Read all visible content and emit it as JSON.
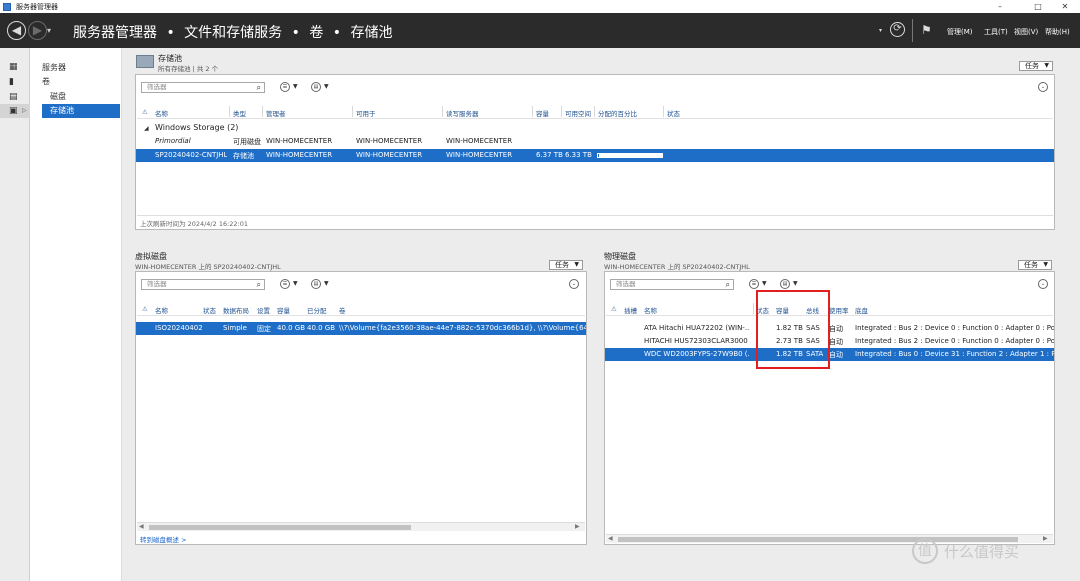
{
  "window": {
    "title": "服务器管理器",
    "minimize": "–",
    "maximize": "□",
    "close": "✕"
  },
  "nav": {
    "back_glyph": "◀",
    "forward_glyph": "▶",
    "dropdown_glyph": "▾",
    "breadcrumb": [
      "服务器管理器",
      "文件和存储服务",
      "卷",
      "存储池"
    ],
    "separator": "•",
    "refresh_glyph": "⟳",
    "flag_glyph": "⚑",
    "menus": [
      "管理(M)",
      "工具(T)",
      "视图(V)",
      "帮助(H)"
    ]
  },
  "rail": {
    "arrow": "▷"
  },
  "tree": {
    "items": [
      "服务器",
      "卷",
      "磁盘",
      "存储池"
    ]
  },
  "storage_pools": {
    "title": "存储池",
    "subtitle": "所有存储池 | 共 2 个",
    "tasks": "任务",
    "filter_placeholder": "筛选器",
    "columns": [
      "名称",
      "类型",
      "管理者",
      "可用于",
      "读写服务器",
      "容量",
      "可用空间",
      "分配的百分比",
      "状态"
    ],
    "group_label": "Windows Storage (2)",
    "group_toggle": "◢",
    "rows": [
      {
        "name": "Primordial",
        "type": "可用磁盘",
        "managed_by": "WIN-HOMECENTER",
        "available_to": "WIN-HOMECENTER",
        "rw_server": "WIN-HOMECENTER",
        "capacity": "",
        "free_space": "",
        "percent_allocated": null,
        "status": ""
      },
      {
        "name": "SP20240402-CNTJHL",
        "type": "存储池",
        "managed_by": "WIN-HOMECENTER",
        "available_to": "WIN-HOMECENTER",
        "rw_server": "WIN-HOMECENTER",
        "capacity": "6.37 TB",
        "free_space": "6.33 TB",
        "percent_allocated": 1,
        "status": ""
      }
    ],
    "last_refresh": "上次刷新时间为 2024/4/2 16:22:01"
  },
  "virtual_disks": {
    "title": "虚拟磁盘",
    "subtitle": "WIN-HOMECENTER 上的 SP20240402-CNTJHL",
    "tasks": "任务",
    "filter_placeholder": "筛选器",
    "columns": [
      "名称",
      "状态",
      "数据布局",
      "设置",
      "容量",
      "已分配",
      "卷"
    ],
    "rows": [
      {
        "name": "ISO20240402",
        "status": "",
        "layout": "Simple",
        "provisioning": "固定",
        "capacity": "40.0 GB",
        "allocated": "40.0 GB",
        "volume": "\\\\?\\Volume{fa2e3560-38ae-44e7-882c-5370dc366b1d}, \\\\?\\Volume{64b2f7"
      }
    ],
    "link": "转到磁盘概述 >"
  },
  "physical_disks": {
    "title": "物理磁盘",
    "subtitle": "WIN-HOMECENTER 上的 SP20240402-CNTJHL",
    "tasks": "任务",
    "filter_placeholder": "筛选器",
    "columns": [
      "插槽",
      "名称",
      "状态",
      "容量",
      "总线",
      "使用率",
      "底盘"
    ],
    "rows": [
      {
        "slot": "",
        "name": "ATA Hitachi HUA72202 (WIN-...",
        "status": "",
        "capacity": "1.82 TB",
        "bus": "SAS",
        "usage": "自动",
        "chassis": "Integrated : Bus 2 : Device 0 : Function 0 : Adapter 0 : Port 0 : T"
      },
      {
        "slot": "",
        "name": "HITACHI HUS72303CLAR3000 (...",
        "status": "",
        "capacity": "2.73 TB",
        "bus": "SAS",
        "usage": "自动",
        "chassis": "Integrated : Bus 2 : Device 0 : Function 0 : Adapter 0 : Port 0 : T"
      },
      {
        "slot": "",
        "name": "WDC WD2003FYPS-27W9B0 (...",
        "status": "",
        "capacity": "1.82 TB",
        "bus": "SATA",
        "usage": "自动",
        "chassis": "Integrated : Bus 0 : Device 31 : Function 2 : Adapter 1 : Port 1"
      }
    ]
  },
  "watermark": {
    "badge": "值",
    "text": "什么值得买"
  },
  "colors": {
    "selection": "#1e6ec8",
    "nav_bg": "#2b2b2b",
    "annotation": "#e21f1f"
  },
  "icons": {
    "filter_search": "search-icon",
    "save_query": "list-icon",
    "filter_options": "filter-icon",
    "expand": "chevron-down-icon"
  }
}
